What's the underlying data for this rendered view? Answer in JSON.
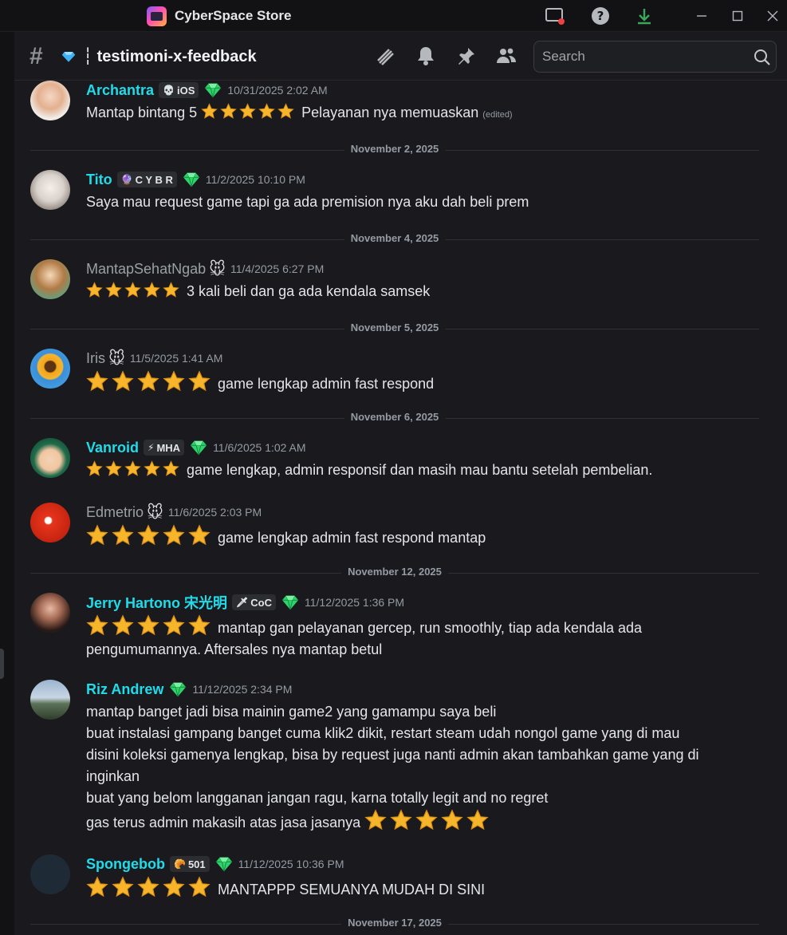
{
  "window": {
    "app_title": "CyberSpace Store"
  },
  "header": {
    "channel_name": "┆ testimoni-x-feedback",
    "search_placeholder": "Search"
  },
  "messages": [
    {
      "username": "Archantra",
      "tag": "iOS",
      "tag_icon": "💀",
      "time": "10/31/2025 2:02 AM",
      "body": "Mantap bintang 5",
      "stars": 5,
      "body_after": "Pelayanan nya memuaskan",
      "edited": "(edited)"
    },
    {
      "username": "Tito",
      "tag": "C Y B R",
      "tag_icon": "🔮",
      "time": "11/2/2025 10:10 PM",
      "body": "Saya mau request game tapi ga ada premision nya aku dah beli prem"
    },
    {
      "username": "MantapSehatNgab",
      "time": "11/4/2025 6:27 PM",
      "stars": 5,
      "body": "3 kali beli dan ga ada kendala samsek"
    },
    {
      "username": "Iris",
      "time": "11/5/2025 1:41 AM",
      "stars": 5,
      "body": "game lengkap admin fast respond"
    },
    {
      "username": "Vanroid",
      "tag": "MHA",
      "tag_icon": "⚡",
      "time": "11/6/2025 1:02 AM",
      "stars": 5,
      "body": "game lengkap, admin responsif dan masih mau bantu setelah pembelian."
    },
    {
      "username": "Edmetrio",
      "time": "11/6/2025 2:03 PM",
      "stars": 5,
      "body": "game lengkap admin fast respond mantap"
    },
    {
      "username": "Jerry Hartono 宋光明",
      "tag": "CoC",
      "tag_icon": "🗡",
      "time": "11/12/2025 1:36 PM",
      "stars": 5,
      "body": "mantap gan pelayanan gercep, run smoothly, tiap ada kendala ada",
      "body_line2": "pengumumannya. Aftersales nya mantap betul"
    },
    {
      "username": "Riz Andrew",
      "time": "11/12/2025 2:34 PM",
      "lines": [
        "mantap banget jadi bisa mainin game2 yang gamampu saya beli",
        "buat instalasi gampang banget cuma klik2 dikit, restart steam udah nongol game yang di mau",
        "disini koleksi gamenya lengkap, bisa by request juga nanti admin akan tambahkan game yang di",
        "inginkan",
        "buat yang belom langganan jangan ragu, karna totally legit and no regret",
        "gas terus admin makasih atas jasa jasanya"
      ],
      "stars": 5
    },
    {
      "username": "Spongebob",
      "tag": "501",
      "tag_icon": "🥐",
      "time": "11/12/2025 10:36 PM",
      "stars": 5,
      "body": "MANTAPPP SEMUANYA MUDAH DI SINI"
    }
  ],
  "dividers": [
    "November 2, 2025",
    "November 4, 2025",
    "November 5, 2025",
    "November 6, 2025",
    "November 12, 2025",
    "November 17, 2025"
  ],
  "colors": {
    "accent_cyan": "#1fdcea",
    "background": "#1a1a1e",
    "star": "#f7b52c",
    "gem": "#2fd36b"
  }
}
